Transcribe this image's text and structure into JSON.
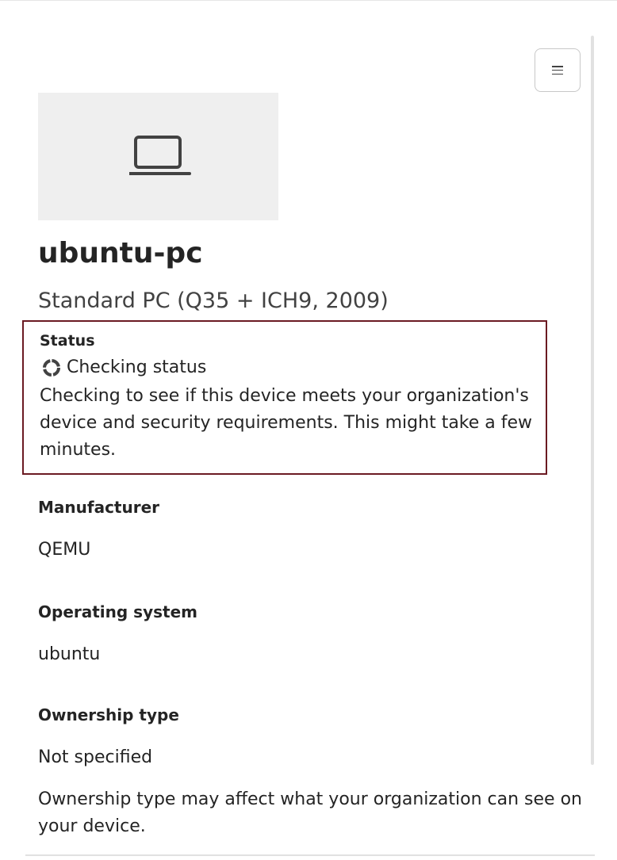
{
  "header": {
    "menu_icon": "hamburger-menu-icon"
  },
  "device": {
    "image_icon": "laptop-icon",
    "name": "ubuntu-pc",
    "model": "Standard PC (Q35 + ICH9, 2009)"
  },
  "status": {
    "label": "Status",
    "icon": "spinner-icon",
    "value": "Checking status",
    "description": "Checking to see if this device meets your organization's device and security requirements. This might take a few minutes.",
    "highlight_color": "#6b1a22"
  },
  "details": {
    "manufacturer_label": "Manufacturer",
    "manufacturer_value": "QEMU",
    "os_label": "Operating system",
    "os_value": "ubuntu",
    "ownership_label": "Ownership type",
    "ownership_value": "Not specified",
    "ownership_note": "Ownership type may affect what your organization can see on your device."
  }
}
